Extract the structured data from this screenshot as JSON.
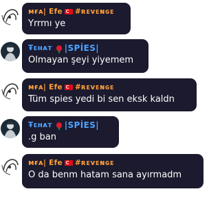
{
  "messages": [
    {
      "author_prefix": "ᴍғᴀ| Efe",
      "author_suffix": "#ʀᴇᴠᴇɴɢᴇ",
      "flag": "turkey-flag",
      "text": "Yrrmı ye"
    },
    {
      "author_prefix": "Ŧᴇʜᴀᴛ",
      "author_suffix": "|SPİES|",
      "flag": "rose",
      "text": "Olmayan şeyi yiyemem"
    },
    {
      "author_prefix": "ᴍғᴀ| Efe",
      "author_suffix": "#ʀᴇᴠᴇɴɢᴇ",
      "flag": "turkey-flag",
      "text": "Tüm spies yedi bi sen eksk kaldn"
    },
    {
      "author_prefix": "Ŧᴇʜᴀᴛ",
      "author_suffix": "|SPİES|",
      "flag": "rose",
      "text": ".g ban"
    },
    {
      "author_prefix": "ᴍғᴀ| Efe",
      "author_suffix": "#ʀᴇᴠᴇɴɢᴇ",
      "flag": "turkey-flag",
      "text": "O da benm hatam sana ayırmadm"
    }
  ],
  "colors": {
    "bubble": "#1b1a2e",
    "efe_name": "#ff9f3a",
    "fehat_name": "#4fa3ff",
    "text": "#ffffff"
  }
}
